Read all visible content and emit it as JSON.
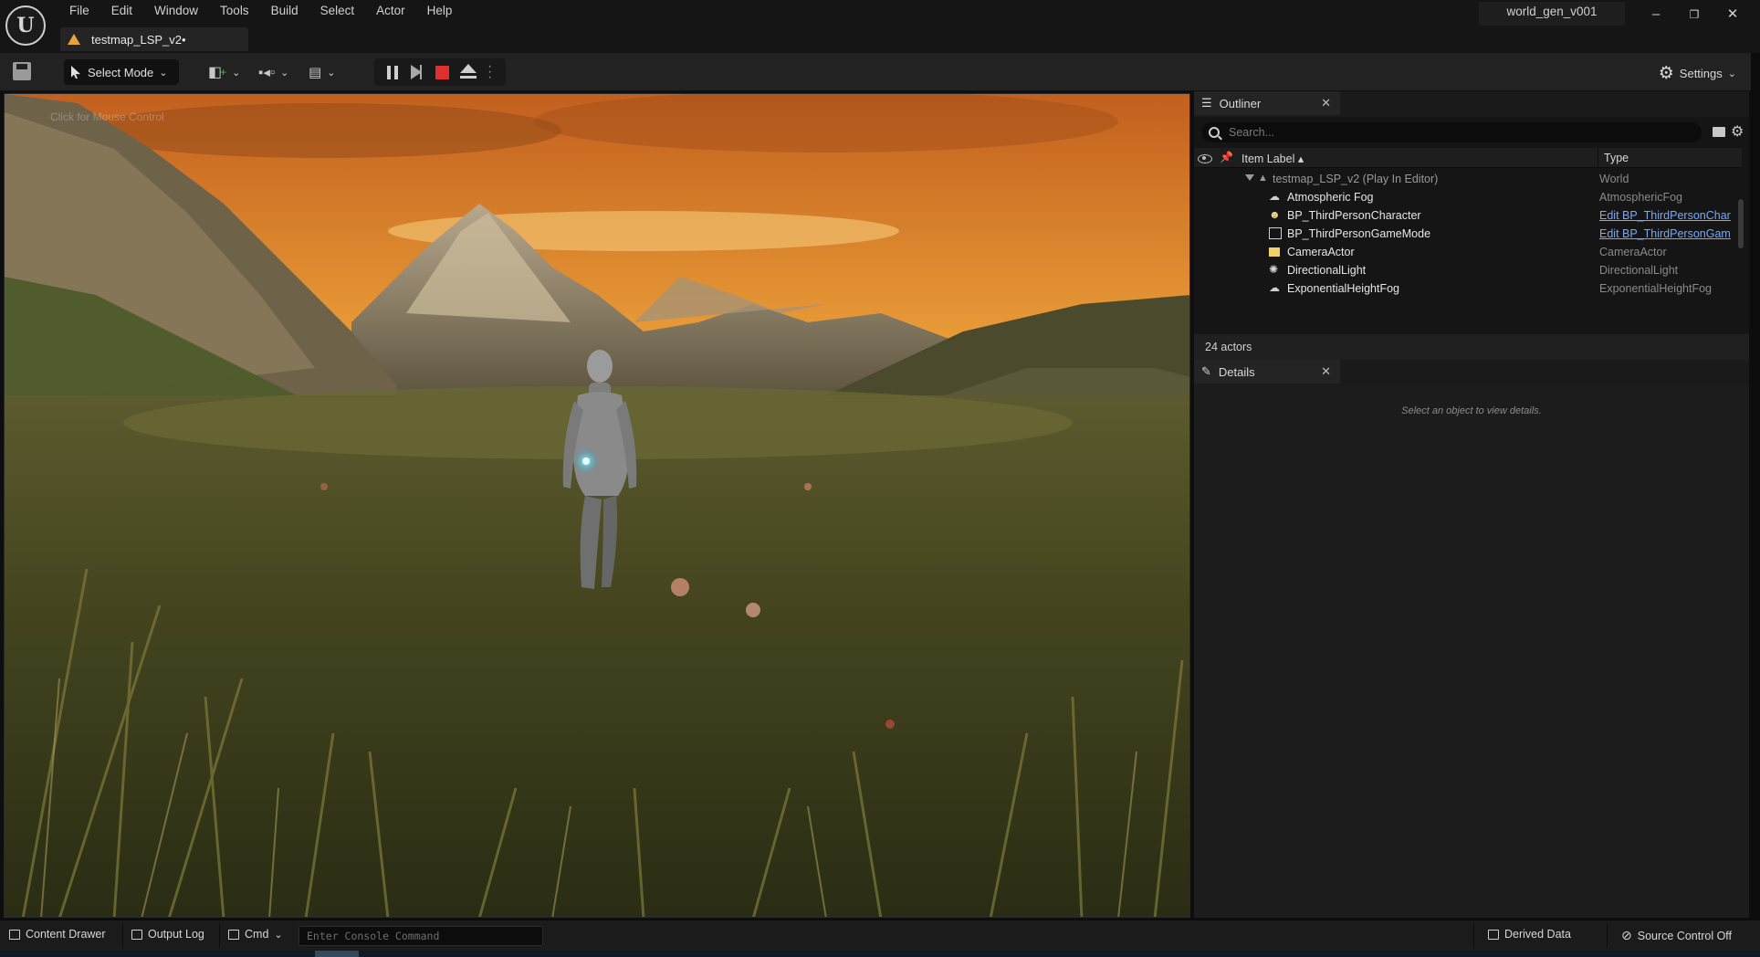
{
  "menu": [
    "File",
    "Edit",
    "Window",
    "Tools",
    "Build",
    "Select",
    "Actor",
    "Help"
  ],
  "project_name": "world_gen_v001",
  "level_tab": "testmap_LSP_v2•",
  "window_controls": {
    "minimize": "–",
    "restore": "❐",
    "close": "✕"
  },
  "toolbar": {
    "select_mode": "Select Mode",
    "settings": "Settings"
  },
  "viewport": {
    "hint": "Click for Mouse Control"
  },
  "outliner": {
    "tab_label": "Outliner",
    "search_placeholder": "Search...",
    "col_label": "Item Label",
    "col_type": "Type",
    "rows": [
      {
        "label": "testmap_LSP_v2 (Play In Editor)",
        "type": "World",
        "icon": "level-icon"
      },
      {
        "label": "Atmospheric Fog",
        "type": "AtmosphericFog",
        "icon": "fog-icon"
      },
      {
        "label": "BP_ThirdPersonCharacter",
        "type": "Edit BP_ThirdPersonChar",
        "icon": "character-icon"
      },
      {
        "label": "BP_ThirdPersonGameMode",
        "type": "Edit BP_ThirdPersonGam",
        "icon": "gamemode-icon"
      },
      {
        "label": "CameraActor",
        "type": "CameraActor",
        "icon": "camera-icon"
      },
      {
        "label": "DirectionalLight",
        "type": "DirectionalLight",
        "icon": "sun-icon"
      },
      {
        "label": "ExponentialHeightFog",
        "type": "ExponentialHeightFog",
        "icon": "fog-icon"
      }
    ],
    "actor_count": "24 actors"
  },
  "details": {
    "tab_label": "Details",
    "empty_message": "Select an object to view details."
  },
  "bottom": {
    "content_drawer": "Content Drawer",
    "output_log": "Output Log",
    "cmd": "Cmd",
    "console_placeholder": "Enter Console Command",
    "derived_data": "Derived Data",
    "source_control": "Source Control Off"
  },
  "colors": {
    "stop": "#e0302c",
    "link": "#74a9ff",
    "warning": "#e8a33a"
  }
}
